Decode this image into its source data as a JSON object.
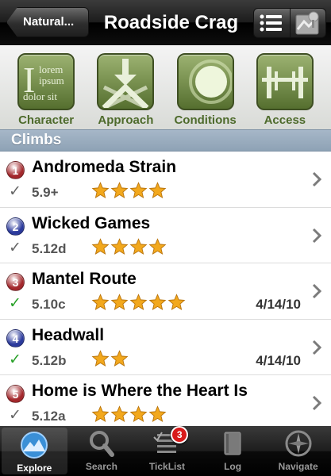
{
  "navbar": {
    "back_label": "Natural...",
    "title": "Roadside Crag",
    "segments": [
      {
        "icon": "list-icon"
      },
      {
        "icon": "map-icon"
      }
    ]
  },
  "toolbar": {
    "items": [
      {
        "label": "Character",
        "icon": "text-page-icon"
      },
      {
        "label": "Approach",
        "icon": "approach-arrow-icon"
      },
      {
        "label": "Conditions",
        "icon": "sun-icon"
      },
      {
        "label": "Access",
        "icon": "gate-icon"
      }
    ]
  },
  "section": {
    "title": "Climbs"
  },
  "climbs": [
    {
      "number": "1",
      "badge_color": "#a3282c",
      "name": "Andromeda Strain",
      "grade": "5.9+",
      "stars": 4,
      "ticked": false,
      "date": ""
    },
    {
      "number": "2",
      "badge_color": "#2b3a9c",
      "name": "Wicked Games",
      "grade": "5.12d",
      "stars": 4,
      "ticked": false,
      "date": ""
    },
    {
      "number": "3",
      "badge_color": "#a3282c",
      "name": "Mantel Route",
      "grade": "5.10c",
      "stars": 5,
      "ticked": true,
      "date": "4/14/10"
    },
    {
      "number": "4",
      "badge_color": "#2b3a9c",
      "name": "Headwall",
      "grade": "5.12b",
      "stars": 2,
      "ticked": true,
      "date": "4/14/10"
    },
    {
      "number": "5",
      "badge_color": "#a3282c",
      "name": "Home is Where the Heart Is",
      "grade": "5.12a",
      "stars": 4,
      "ticked": false,
      "date": ""
    }
  ],
  "tabs": [
    {
      "label": "Explore",
      "icon": "mountain-icon",
      "selected": true,
      "badge": ""
    },
    {
      "label": "Search",
      "icon": "magnifier-icon",
      "selected": false,
      "badge": ""
    },
    {
      "label": "TickList",
      "icon": "checklist-icon",
      "selected": false,
      "badge": "3"
    },
    {
      "label": "Log",
      "icon": "book-icon",
      "selected": false,
      "badge": ""
    },
    {
      "label": "Navigate",
      "icon": "compass-icon",
      "selected": false,
      "badge": ""
    }
  ],
  "colors": {
    "tick_green": "#2aa12a",
    "tick_gray": "#666666",
    "star_gold": "#f2a81d",
    "toolbar_label": "#4d6a2b"
  }
}
